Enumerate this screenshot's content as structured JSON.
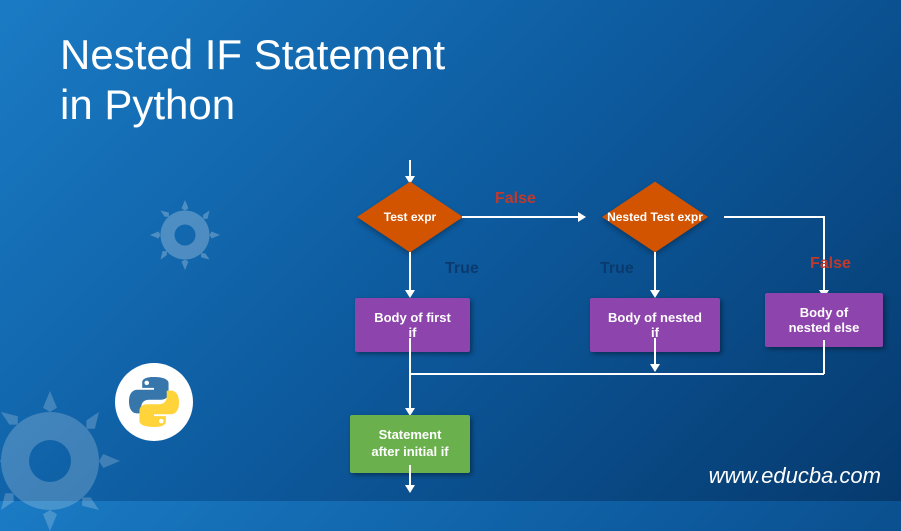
{
  "title_line1": "Nested IF Statement",
  "title_line2": "in Python",
  "url": "www.educba.com",
  "flow": {
    "test_expr": "Test expr",
    "nested_test_expr": "Nested Test  expr",
    "body_first_if": "Body of first if",
    "body_nested_if": "Body of nested if",
    "body_nested_else": "Body of nested else",
    "statement_after": "Statement after initial if",
    "label_true": "True",
    "label_false": "False"
  }
}
